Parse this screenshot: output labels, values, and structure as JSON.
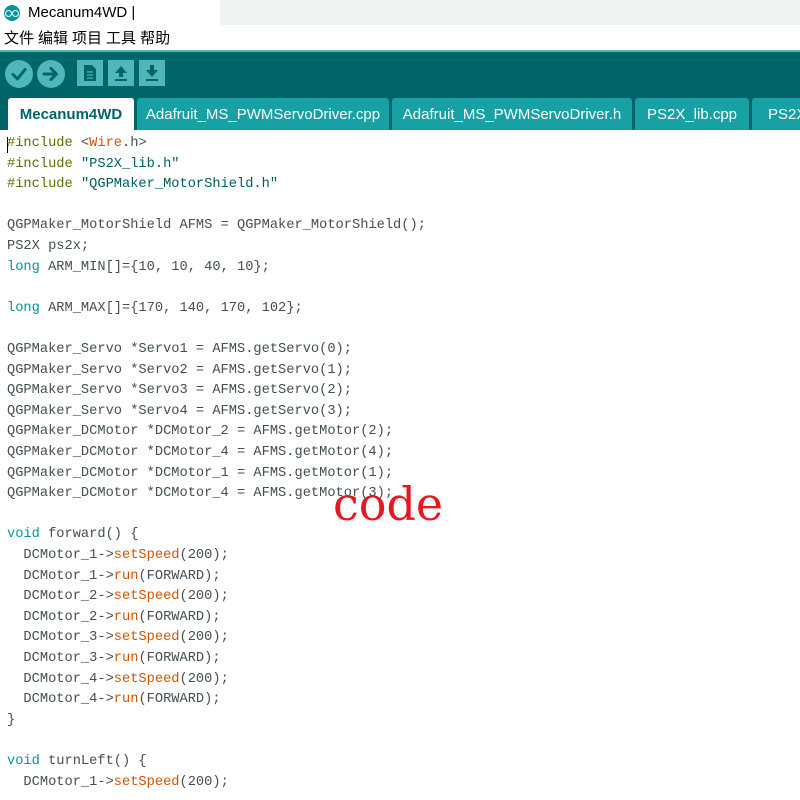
{
  "window": {
    "title": "Mecanum4WD |"
  },
  "menu": [
    "文件",
    "编辑",
    "项目",
    "工具",
    "帮助"
  ],
  "toolbar": {
    "buttons": [
      "verify-icon",
      "upload-icon",
      "new-icon",
      "open-icon",
      "save-icon"
    ]
  },
  "tabs": [
    "Mecanum4WD",
    "Adafruit_MS_PWMServoDriver.cpp",
    "Adafruit_MS_PWMServoDriver.h",
    "PS2X_lib.cpp",
    "PS2X"
  ],
  "watermark": "code",
  "colors": {
    "toolbar_bg": "#006468",
    "button": "#4db7bb",
    "tab": "#17a1a5",
    "keyword": "#5e6d03",
    "type": "#00979c",
    "function": "#d35400",
    "watermark": "#e8161d"
  },
  "code": [
    [
      [
        "kw",
        "#include "
      ],
      [
        "tx",
        "<"
      ],
      [
        "fn",
        "Wire"
      ],
      [
        "tx",
        ".h>"
      ]
    ],
    [
      [
        "kw",
        "#include "
      ],
      [
        "str",
        "\"PS2X_lib.h\""
      ]
    ],
    [
      [
        "kw",
        "#include "
      ],
      [
        "str",
        "\"QGPMaker_MotorShield.h\""
      ]
    ],
    [],
    [
      [
        "tx",
        "QGPMaker_MotorShield AFMS = QGPMaker_MotorShield();"
      ]
    ],
    [
      [
        "tx",
        "PS2X ps2x;"
      ]
    ],
    [
      [
        "ty",
        "long"
      ],
      [
        "tx",
        " ARM_MIN[]={10, 10, 40, 10};"
      ]
    ],
    [],
    [
      [
        "ty",
        "long"
      ],
      [
        "tx",
        " ARM_MAX[]={170, 140, 170, 102};"
      ]
    ],
    [],
    [
      [
        "tx",
        "QGPMaker_Servo *Servo1 = AFMS.getServo(0);"
      ]
    ],
    [
      [
        "tx",
        "QGPMaker_Servo *Servo2 = AFMS.getServo(1);"
      ]
    ],
    [
      [
        "tx",
        "QGPMaker_Servo *Servo3 = AFMS.getServo(2);"
      ]
    ],
    [
      [
        "tx",
        "QGPMaker_Servo *Servo4 = AFMS.getServo(3);"
      ]
    ],
    [
      [
        "tx",
        "QGPMaker_DCMotor *DCMotor_2 = AFMS.getMotor(2);"
      ]
    ],
    [
      [
        "tx",
        "QGPMaker_DCMotor *DCMotor_4 = AFMS.getMotor(4);"
      ]
    ],
    [
      [
        "tx",
        "QGPMaker_DCMotor *DCMotor_1 = AFMS.getMotor(1);"
      ]
    ],
    [
      [
        "tx",
        "QGPMaker_DCMotor *DCMotor_4 = AFMS.getMotor(3);"
      ]
    ],
    [],
    [
      [
        "ty",
        "void"
      ],
      [
        "tx",
        " forward() {"
      ]
    ],
    [
      [
        "tx",
        "  DCMotor_1->"
      ],
      [
        "fn",
        "setSpeed"
      ],
      [
        "tx",
        "(200);"
      ]
    ],
    [
      [
        "tx",
        "  DCMotor_1->"
      ],
      [
        "fn",
        "run"
      ],
      [
        "tx",
        "(FORWARD);"
      ]
    ],
    [
      [
        "tx",
        "  DCMotor_2->"
      ],
      [
        "fn",
        "setSpeed"
      ],
      [
        "tx",
        "(200);"
      ]
    ],
    [
      [
        "tx",
        "  DCMotor_2->"
      ],
      [
        "fn",
        "run"
      ],
      [
        "tx",
        "(FORWARD);"
      ]
    ],
    [
      [
        "tx",
        "  DCMotor_3->"
      ],
      [
        "fn",
        "setSpeed"
      ],
      [
        "tx",
        "(200);"
      ]
    ],
    [
      [
        "tx",
        "  DCMotor_3->"
      ],
      [
        "fn",
        "run"
      ],
      [
        "tx",
        "(FORWARD);"
      ]
    ],
    [
      [
        "tx",
        "  DCMotor_4->"
      ],
      [
        "fn",
        "setSpeed"
      ],
      [
        "tx",
        "(200);"
      ]
    ],
    [
      [
        "tx",
        "  DCMotor_4->"
      ],
      [
        "fn",
        "run"
      ],
      [
        "tx",
        "(FORWARD);"
      ]
    ],
    [
      [
        "tx",
        "}"
      ]
    ],
    [],
    [
      [
        "ty",
        "void"
      ],
      [
        "tx",
        " turnLeft() {"
      ]
    ],
    [
      [
        "tx",
        "  DCMotor_1->"
      ],
      [
        "fn",
        "setSpeed"
      ],
      [
        "tx",
        "(200);"
      ]
    ]
  ]
}
